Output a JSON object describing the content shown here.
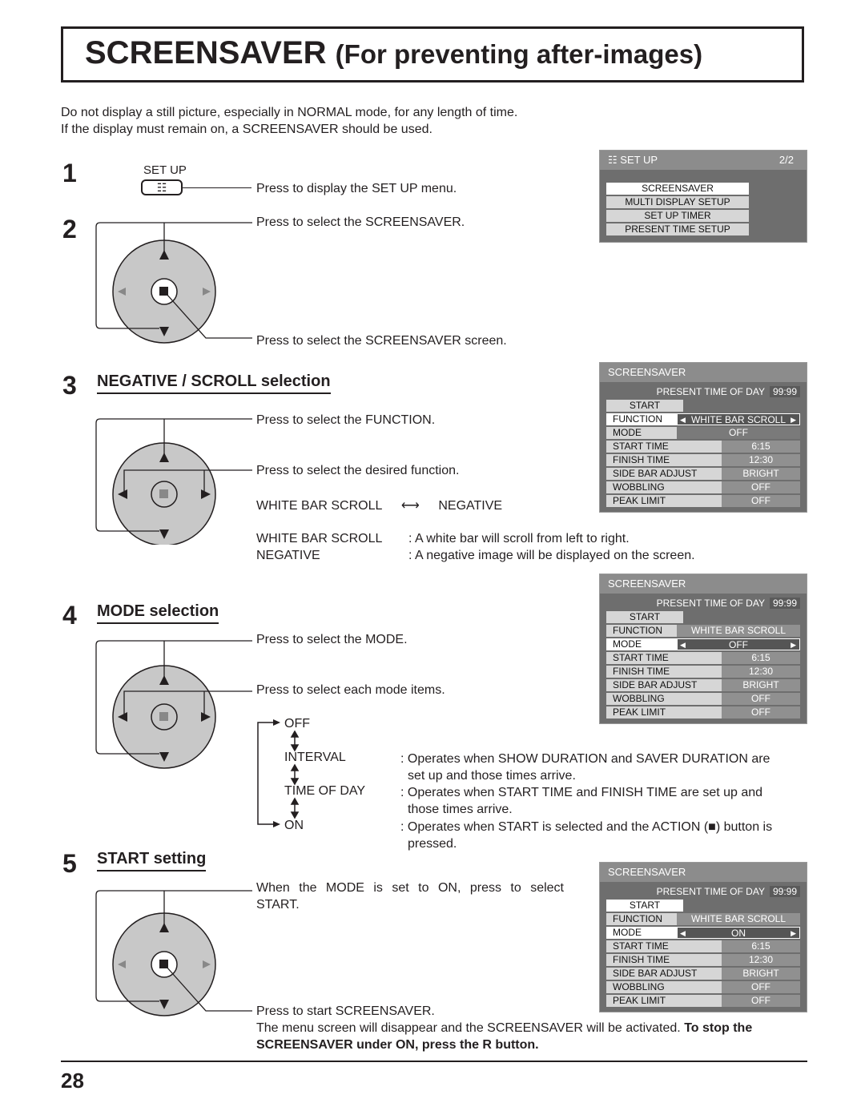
{
  "title": {
    "main": "SCREENSAVER",
    "sub": "(For preventing after-images)"
  },
  "intro": [
    "Do not display a still picture, especially in NORMAL mode, for any length of time.",
    "If the display must remain on, a SCREENSAVER should be used."
  ],
  "steps": {
    "s1": {
      "num": "1",
      "button_label": "SET UP",
      "text": "Press to display the SET UP menu."
    },
    "s2": {
      "num": "2",
      "text_select": "Press to select the SCREENSAVER.",
      "text_enter": "Press to select the SCREENSAVER screen."
    },
    "s3": {
      "num": "3",
      "heading": "NEGATIVE / SCROLL selection",
      "text_select": "Press to select the FUNCTION.",
      "text_desired": "Press to select the desired function.",
      "toggle_left": "WHITE BAR SCROLL",
      "toggle_right": "NEGATIVE",
      "defs": [
        {
          "term": "WHITE BAR SCROLL",
          "desc": ": A white bar will scroll from left to right."
        },
        {
          "term": "NEGATIVE",
          "desc": ": A negative image will be displayed on the screen."
        }
      ]
    },
    "s4": {
      "num": "4",
      "heading": "MODE selection",
      "text_select": "Press to select the MODE.",
      "text_each": "Press to select each mode items.",
      "modes": [
        "OFF",
        "INTERVAL",
        "TIME OF DAY",
        "ON"
      ],
      "descs": {
        "interval_1": ": Operates when SHOW DURATION and SAVER DURATION are",
        "interval_2": "set up and those times arrive.",
        "tod_1": ": Operates when START TIME and FINISH TIME are set up and",
        "tod_2": "those times arrive.",
        "on_1": ": Operates when START is selected and the ACTION (■) button is",
        "on_2": "pressed."
      }
    },
    "s5": {
      "num": "5",
      "heading": "START setting",
      "text_select_1": "When the MODE is set to ON, press to select",
      "text_select_2": "START.",
      "text_start": "Press to start SCREENSAVER.",
      "note_plain": "The menu screen will disappear and the SCREENSAVER will be activated. ",
      "note_bold_1": "To stop the",
      "note_bold_2": "SCREENSAVER under ON, press the R button."
    }
  },
  "setup_menu": {
    "title": "SET UP",
    "page": "2/2",
    "items": [
      "SCREENSAVER",
      "MULTI DISPLAY SETUP",
      "SET UP TIMER",
      "PRESENT TIME SETUP"
    ],
    "selected": "SCREENSAVER"
  },
  "ss_menus": [
    {
      "title": "SCREENSAVER",
      "ptod_label": "PRESENT  TIME OF DAY",
      "ptod_value": "99:99",
      "start": "START",
      "function": {
        "label": "FUNCTION",
        "value": "WHITE BAR SCROLL"
      },
      "mode": {
        "label": "MODE",
        "value": "OFF"
      },
      "rows": [
        {
          "label": "START TIME",
          "value": "6:15"
        },
        {
          "label": "FINISH TIME",
          "value": "12:30"
        },
        {
          "label": "SIDE BAR ADJUST",
          "value": "BRIGHT"
        },
        {
          "label": "WOBBLING",
          "value": "OFF"
        },
        {
          "label": "PEAK LIMIT",
          "value": "OFF"
        }
      ],
      "selected": "FUNCTION"
    },
    {
      "title": "SCREENSAVER",
      "ptod_label": "PRESENT  TIME OF DAY",
      "ptod_value": "99:99",
      "start": "START",
      "function": {
        "label": "FUNCTION",
        "value": "WHITE BAR SCROLL"
      },
      "mode": {
        "label": "MODE",
        "value": "OFF"
      },
      "rows": [
        {
          "label": "START TIME",
          "value": "6:15"
        },
        {
          "label": "FINISH TIME",
          "value": "12:30"
        },
        {
          "label": "SIDE BAR ADJUST",
          "value": "BRIGHT"
        },
        {
          "label": "WOBBLING",
          "value": "OFF"
        },
        {
          "label": "PEAK LIMIT",
          "value": "OFF"
        }
      ],
      "selected": "MODE"
    },
    {
      "title": "SCREENSAVER",
      "ptod_label": "PRESENT  TIME OF DAY",
      "ptod_value": "99:99",
      "start": "START",
      "function": {
        "label": "FUNCTION",
        "value": "WHITE BAR SCROLL"
      },
      "mode": {
        "label": "MODE",
        "value": "ON"
      },
      "rows": [
        {
          "label": "START TIME",
          "value": "6:15"
        },
        {
          "label": "FINISH TIME",
          "value": "12:30"
        },
        {
          "label": "SIDE BAR ADJUST",
          "value": "BRIGHT"
        },
        {
          "label": "WOBBLING",
          "value": "OFF"
        },
        {
          "label": "PEAK LIMIT",
          "value": "OFF"
        }
      ],
      "selected": "MODE_START"
    }
  ],
  "page_number": "28",
  "icons": {
    "menu": "☷",
    "action": "■"
  }
}
